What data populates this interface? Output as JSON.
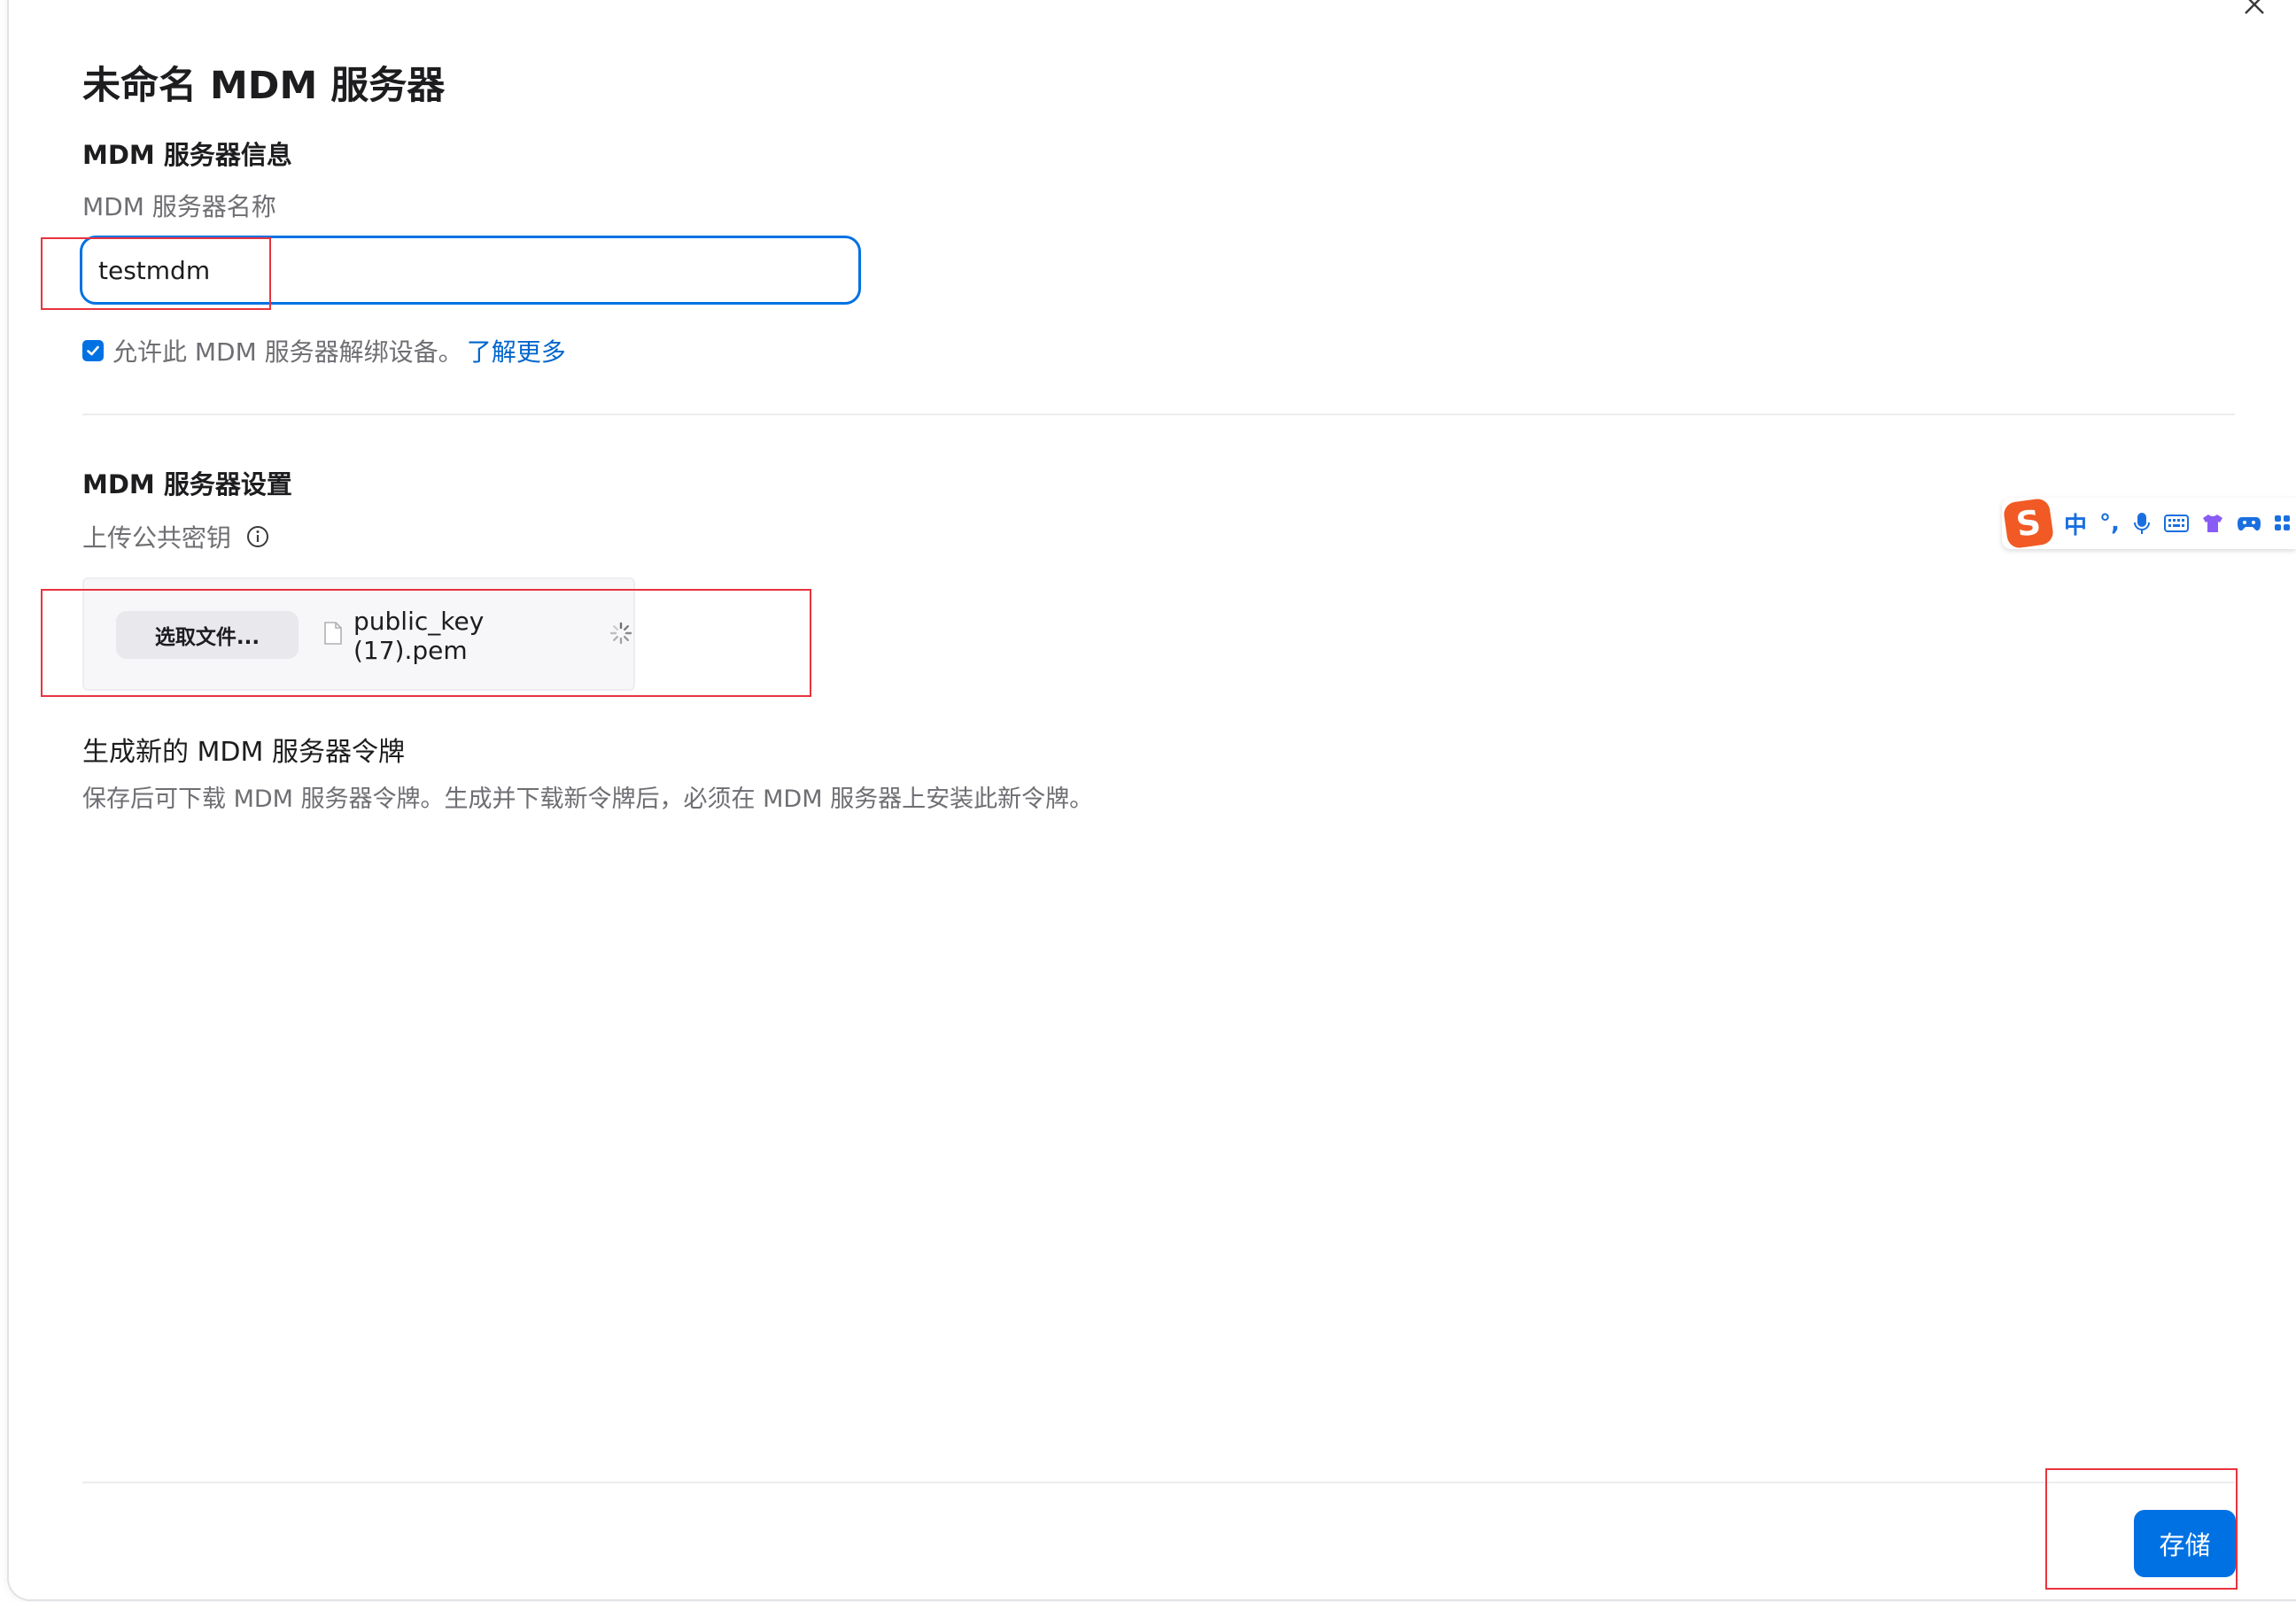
{
  "dialog": {
    "title": "未命名 MDM 服务器",
    "close_label": "×"
  },
  "server_info": {
    "heading": "MDM 服务器信息",
    "name_label": "MDM 服务器名称",
    "name_value": "testmdm",
    "allow_release_checked": true,
    "allow_release_text": "允许此 MDM 服务器解绑设备。",
    "learn_more": "了解更多"
  },
  "server_settings": {
    "heading": "MDM 服务器设置",
    "upload_label": "上传公共密钥",
    "choose_file_button": "选取文件...",
    "file_name": "public_key (17).pem",
    "token_title": "生成新的 MDM 服务器令牌",
    "token_description": "保存后可下载 MDM 服务器令牌。生成并下载新令牌后，必须在 MDM 服务器上安装此新令牌。"
  },
  "footer": {
    "save_button": "存储"
  },
  "ime_toolbar": {
    "logo": "S",
    "mode": "中",
    "punct": "°,",
    "icons": [
      "mic-icon",
      "keyboard-icon",
      "shirt-icon",
      "gamepad-icon",
      "grid-icon"
    ]
  },
  "colors": {
    "accent": "#0071e3",
    "link": "#0066cc",
    "annotation": "#e8333e",
    "ime_brand": "#f15a24"
  }
}
